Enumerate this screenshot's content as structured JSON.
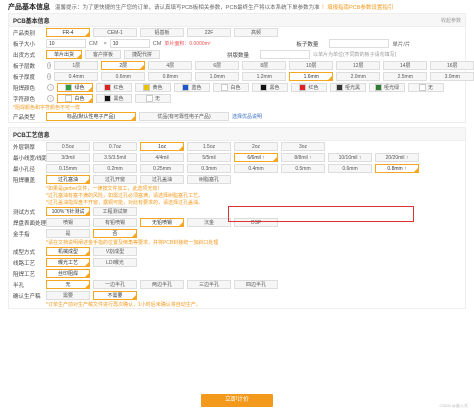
{
  "topbar": {
    "title": "产品基本信息",
    "desc": "温馨提示：为了更快捷的生产您的订单，请认真填写PCB板相关参数，PCB最终生产将以本系统下单参数为准",
    "link": "！填报指南PCB参数设置指引"
  },
  "basic": {
    "title": "PCB基本信息",
    "fold": "收起参数",
    "material": {
      "label": "产品类别",
      "options": [
        "FR-4",
        "CEM-1",
        "铝基板",
        "22F",
        "高频"
      ],
      "selected": 0
    },
    "size": {
      "label": "板子大小",
      "w": "10",
      "h": "10",
      "unit1": "CM",
      "unit2": "CM",
      "area": "单片面积：0.0000m²",
      "count_label": "板子数量",
      "count_unit": "单片/片"
    },
    "shipment": {
      "label": "出货方式",
      "options": [
        "单片出货",
        "客户拼板",
        "捷配代拼"
      ],
      "selected": 0,
      "count_label": "拼版数量",
      "hint": "以单片为单位(不同款的板子请勿填写)"
    },
    "layers": {
      "label": "板子层数",
      "options": [
        "1层",
        "2层",
        "4层",
        "6层",
        "8层",
        "10层",
        "12层",
        "14层",
        "16层"
      ],
      "selected": 1
    },
    "thickness": {
      "label": "板子厚度",
      "options": [
        "0.4mm",
        "0.6mm",
        "0.8mm",
        "1.0mm",
        "1.2mm",
        "1.6mm",
        "2.0mm",
        "2.5mm",
        "3.0mm"
      ],
      "selected": 5
    },
    "solder_color": {
      "label": "阻焊颜色",
      "options": [
        "绿色",
        "红色",
        "黄色",
        "蓝色",
        "白色",
        "黑色",
        "红色",
        "哑光黑",
        "哑光绿",
        "无"
      ],
      "swatches": [
        "#2e9d3f",
        "#d22",
        "#e8c400",
        "#1d57c7",
        "#ffffff",
        "#111",
        "#d22",
        "#333",
        "#2e7d32",
        "#fff"
      ],
      "selected": 0
    },
    "silk_color": {
      "label": "字符颜色",
      "options": [
        "白色",
        "黑色",
        "无"
      ],
      "swatches": [
        "#ffffff",
        "#111",
        "#fff"
      ],
      "selected": 0
    },
    "silk_note": "*阻焊颜色和字符颜色不可一样",
    "product_type": {
      "label": "产品类型",
      "options": [
        "标品(默认性电子产品)",
        "优品(有可靠性电子产品)"
      ],
      "selected": 0,
      "link": "选择优品说明"
    }
  },
  "process": {
    "title": "PCB工艺信息",
    "outer_copper": {
      "label": "外层铜厚",
      "options": [
        "0.5oz",
        "0.7oz",
        "1oz",
        "1.5oz",
        "2oz",
        "3oz"
      ],
      "selected": 2
    },
    "trace": {
      "label": "最小线宽/线距",
      "options": [
        "3/3mil",
        "3.5/3.5mil",
        "4/4mil",
        "5/5mil",
        "6/6mil ↑",
        "8/8mil ↑",
        "10/10mil ↑",
        "20/20mil ↑"
      ],
      "selected": 4
    },
    "hole": {
      "label": "最小孔径",
      "options": [
        "0.15mm",
        "0.2mm",
        "0.25mm",
        "0.3mm",
        "0.4mm",
        "0.5mm",
        "0.6mm",
        "0.8mm ↑"
      ],
      "selected": 7
    },
    "solder_cover": {
      "label": "阻焊覆盖",
      "options": [
        "过孔塞油",
        "过孔开窗",
        "过孔盖油",
        "树脂塞孔"
      ],
      "selected": 0
    },
    "cover_note1": "*如果是gerber文件，一律按文件加工，此选项无效！",
    "cover_note2": "*过孔塞油有塞不满的风险，如需过孔必须塞满，请选择树脂塞孔工艺。",
    "cover_note3": "*过孔盖油指焊盘不开窗，露铜可能，对此有要求的，请选择过孔盖油。",
    "test": {
      "label": "测试方式",
      "options": [
        "100%飞针测试",
        "工程测试架"
      ],
      "selected": 0
    },
    "finish": {
      "label": "焊盘表面处理",
      "options": [
        "喷锡",
        "有铅喷锡",
        "无铅喷锡",
        "沉金",
        "OSP"
      ],
      "selected": 2
    },
    "gold_finger": {
      "label": "金手指",
      "options": [
        "是",
        "否"
      ],
      "selected": 1
    },
    "gold_note": "*请在文档说明阐述金手指的位置及倒角等要求，并将PCB封装统一加斜口处理",
    "profile": {
      "label": "成型方式",
      "options": [
        "机械成型",
        "V割成型"
      ],
      "selected": 0
    },
    "copper_process": {
      "label": "线路工艺",
      "options": [
        "曝光工艺",
        "LDI曝光"
      ],
      "selected": 0
    },
    "solder_process": {
      "label": "阻焊工艺",
      "options": [
        "丝印阻焊"
      ],
      "selected": 0
    },
    "half_hole": {
      "label": "半孔",
      "options": [
        "无",
        "一边半孔",
        "两边半孔",
        "三边半孔",
        "四边半孔"
      ],
      "selected": 0
    },
    "confirm": {
      "label": "确认生产稿",
      "options": [
        "需要",
        "不需要"
      ],
      "selected": 1
    },
    "confirm_note": "*订单生产前对生产稿文件进行再次确认，1小时后未确认将自动生产。"
  },
  "submit": "立即计价",
  "watermark": "CSDN @嵌入式"
}
